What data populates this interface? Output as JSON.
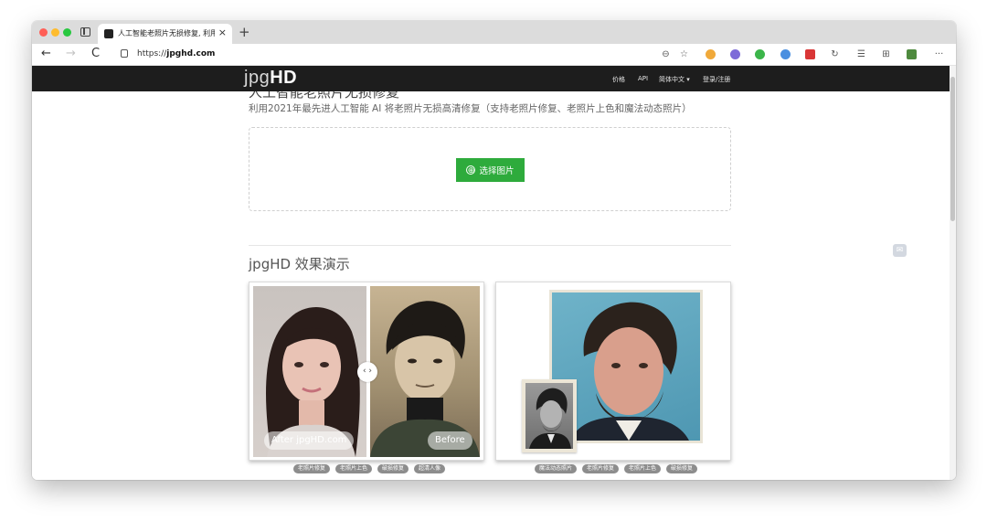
{
  "browser": {
    "tab_title": "人工智能老照片无损修复, 利用2",
    "tab_close": "×",
    "new_tab": "+",
    "url_prefix": "https://",
    "url_domain": "jpghd.com",
    "nav_back": "←",
    "nav_forward": "→",
    "nav_reload": "C",
    "more_menu": "···"
  },
  "site": {
    "logo_thin": "jpg",
    "logo_bold": "HD",
    "menu": [
      "价格",
      "API",
      "简体中文 ▾",
      "登录/注册"
    ],
    "ghost_title": "人工智能老照片无损修复",
    "subtitle": "利用2021年最先进人工智能 AI 将老照片无损高清修复（支持老照片修复、老照片上色和魔法动态照片）",
    "select_button": "选择图片",
    "select_button_icon": "⊕",
    "demo_title": "jpgHD 效果演示",
    "compare_handle": "‹ ›",
    "after_label": "After jpgHD.com",
    "before_label": "Before",
    "card1_tags": [
      "老照片修复",
      "老照片上色",
      "破损修复",
      "超清人像"
    ],
    "card2_tags": [
      "魔法动态照片",
      "老照片修复",
      "老照片上色",
      "破损修复"
    ]
  },
  "colors": {
    "header_bg": "#1d1d1d",
    "accent_green": "#2eab3c",
    "tag_gray": "#8d8d8d"
  }
}
